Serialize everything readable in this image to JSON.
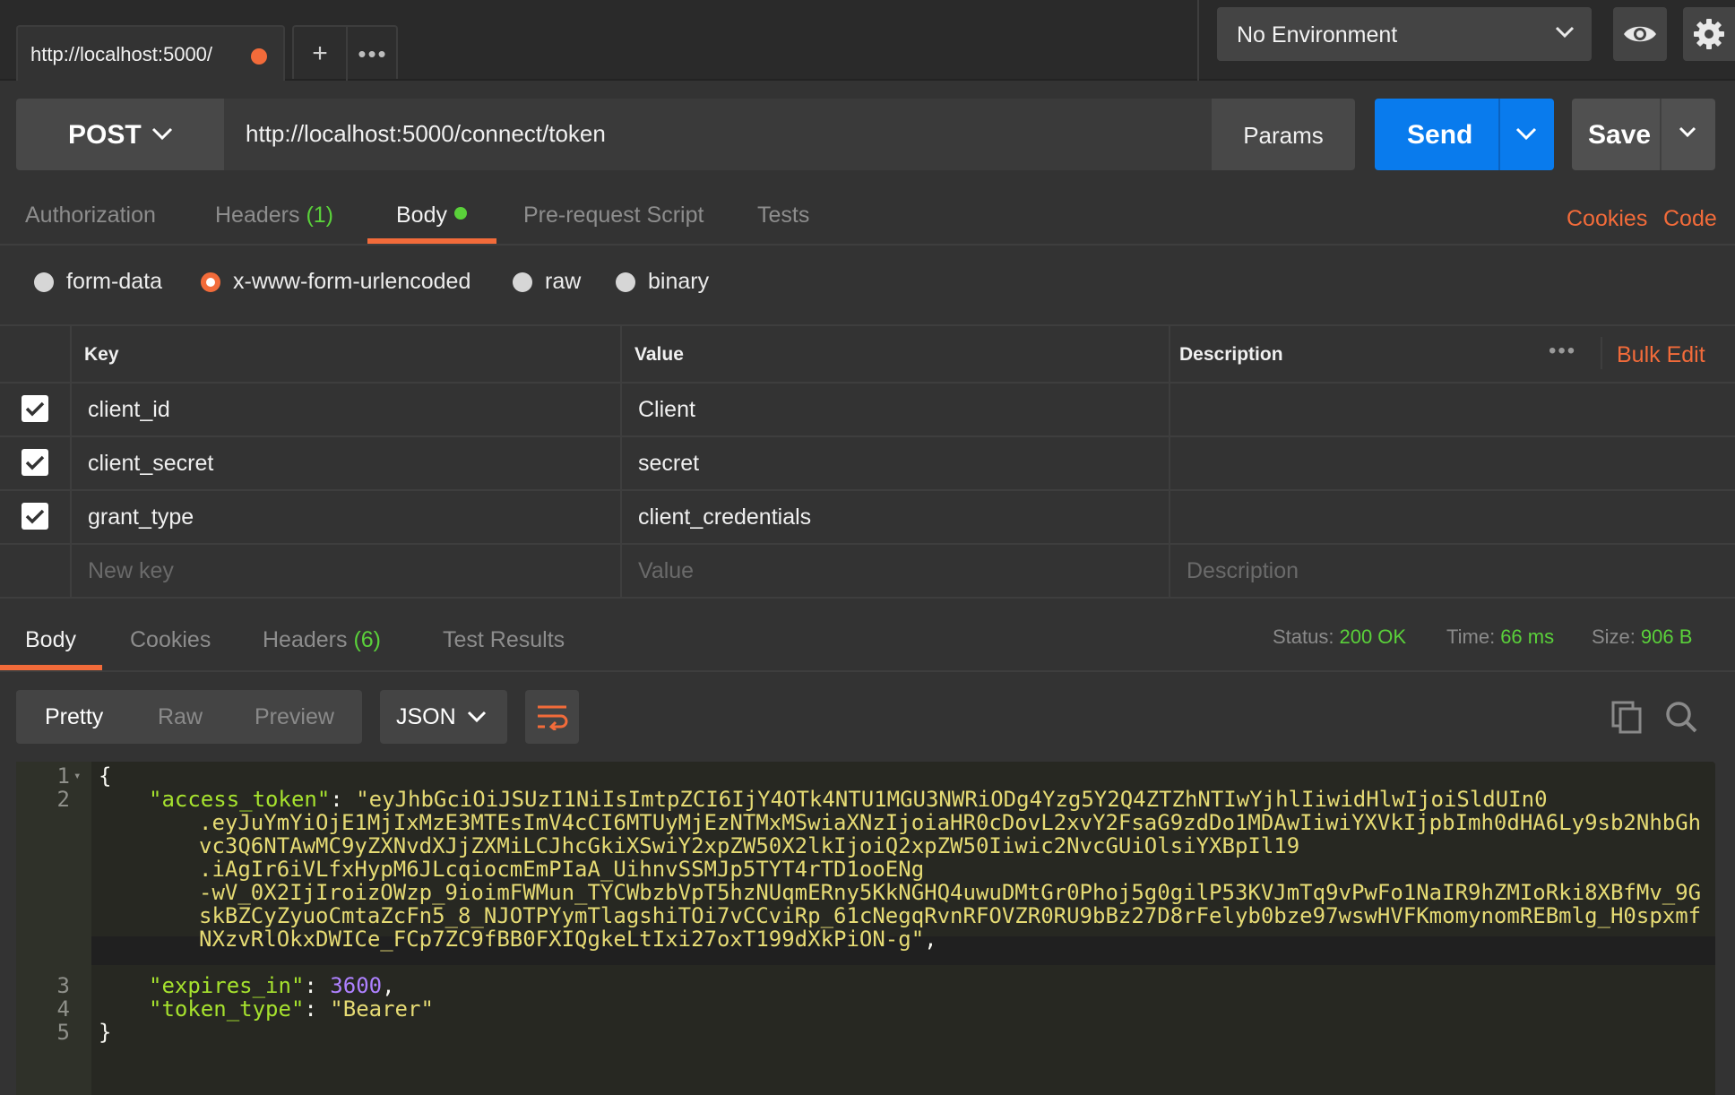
{
  "tab": {
    "title": "http://localhost:5000/"
  },
  "environment": {
    "selected": "No Environment"
  },
  "request": {
    "method": "POST",
    "url": "http://localhost:5000/connect/token",
    "params_label": "Params",
    "send_label": "Send",
    "save_label": "Save"
  },
  "request_tabs": {
    "authorization": "Authorization",
    "headers": "Headers",
    "headers_count": "(1)",
    "body": "Body",
    "prerequest": "Pre-request Script",
    "tests": "Tests",
    "cookies": "Cookies",
    "code": "Code"
  },
  "body_types": {
    "form_data": "form-data",
    "urlencoded": "x-www-form-urlencoded",
    "raw": "raw",
    "binary": "binary",
    "selected": "x-www-form-urlencoded"
  },
  "kv_table": {
    "headers": {
      "key": "Key",
      "value": "Value",
      "description": "Description",
      "bulk_edit": "Bulk Edit"
    },
    "rows": [
      {
        "key": "client_id",
        "value": "Client",
        "description": "",
        "checked": true
      },
      {
        "key": "client_secret",
        "value": "secret",
        "description": "",
        "checked": true
      },
      {
        "key": "grant_type",
        "value": "client_credentials",
        "description": "",
        "checked": true
      }
    ],
    "placeholders": {
      "key": "New key",
      "value": "Value",
      "description": "Description"
    }
  },
  "response_tabs": {
    "body": "Body",
    "cookies": "Cookies",
    "headers": "Headers",
    "headers_count": "(6)",
    "test_results": "Test Results"
  },
  "status": {
    "status_label": "Status:",
    "status_value": "200 OK",
    "time_label": "Time:",
    "time_value": "66 ms",
    "size_label": "Size:",
    "size_value": "906 B"
  },
  "response_view": {
    "pretty": "Pretty",
    "raw": "Raw",
    "preview": "Preview",
    "format": "JSON"
  },
  "code": {
    "line_numbers": [
      "1",
      "2",
      "3",
      "4",
      "5"
    ],
    "open_brace": "{",
    "close_brace": "}",
    "access_token_key": "\"access_token\"",
    "access_token_lines": [
      "\"eyJhbGciOiJSUzI1NiIsImtpZCI6IjY4OTk4NTU1MGU3NWRiODg4Yzg5Y2Q4ZTZhNTIwYjhlIiwidHlwIjoiSldUIn0",
      ".eyJuYmYiOjE1MjIxMzE3MTEsImV4cCI6MTUyMjEzNTMxMSwiaXNzIjoiaHR0cDovL2xvY2FsaG9zdDo1MDAwIiwiYXVkIjpbImh0dHA6Ly9sb2NhbGh",
      "vc3Q6NTAwMC9yZXNvdXJjZXMiLCJhcGkiXSwiY2xpZW50X2lkIjoiQ2xpZW50Iiwic2NvcGUiOlsiYXBpIl19",
      ".iAgIr6iVLfxHypM6JLcqiocmEmPIaA_UihnvSSMJp5TYT4rTD1ooENg",
      "-wV_0X2IjIroizOWzp_9ioimFWMun_TYCWbzbVpT5hzNUqmERny5KkNGHQ4uwuDMtGr0Phoj5g0gilP53KVJmTq9vPwFo1NaIR9hZMIoRki8XBfMv_9G",
      "skBZCyZyuoCmtaZcFn5_8_NJOTPYymTlagshiTOi7vCCviRp_61cNegqRvnRFOVZR0RU9bBz27D8rFelyb0bze97wswHVFKmomynomREBmlg_H0spxmf",
      "NXzvRlOkxDWICe_FCp7ZC9fBB0FXIQgkeLtIxi27oxT199dXkPiON-g\""
    ],
    "expires_in_key": "\"expires_in\"",
    "expires_in_value": "3600",
    "token_type_key": "\"token_type\"",
    "token_type_value": "\"Bearer\""
  },
  "colors": {
    "accent": "#f26b3a",
    "send": "#097bed",
    "success": "#5ad13a"
  }
}
